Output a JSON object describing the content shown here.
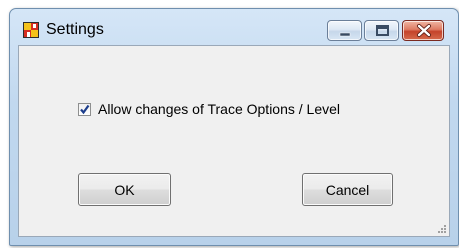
{
  "window": {
    "title": "Settings",
    "icon": "settings-app-icon"
  },
  "title_buttons": {
    "minimize_icon": "minimize-icon",
    "maximize_icon": "maximize-icon",
    "close_icon": "close-icon"
  },
  "options": {
    "allow_trace_changes": {
      "label": "Allow changes of Trace Options / Level",
      "checked": true
    }
  },
  "buttons": {
    "ok_label": "OK",
    "cancel_label": "Cancel"
  },
  "colors": {
    "close_button": "#c4432a",
    "checkmark": "#1d3e8c",
    "titlebar": "#c1d8ef"
  }
}
